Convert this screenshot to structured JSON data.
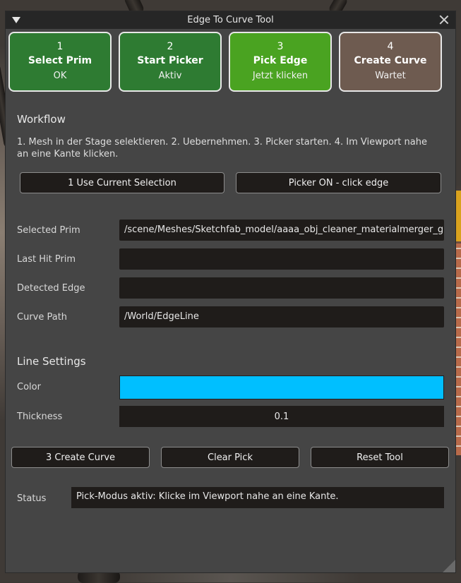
{
  "window": {
    "title": "Edge To Curve Tool"
  },
  "steps": [
    {
      "num": "1",
      "title": "Select Prim",
      "state": "OK"
    },
    {
      "num": "2",
      "title": "Start Picker",
      "state": "Aktiv"
    },
    {
      "num": "3",
      "title": "Pick Edge",
      "state": "Jetzt klicken"
    },
    {
      "num": "4",
      "title": "Create Curve",
      "state": "Wartet"
    }
  ],
  "workflow": {
    "title": "Workflow",
    "description": "1. Mesh in der Stage selektieren. 2. Uebernehmen. 3. Picker starten. 4. Im Viewport nahe an eine Kante klicken.",
    "use_selection_label": "1  Use Current Selection",
    "picker_label": "Picker ON - click edge"
  },
  "fields": {
    "selected_prim_label": "Selected Prim",
    "selected_prim_value": "/scene/Meshes/Sketchfab_model/aaaa_obj_cleaner_materialmerger_g",
    "last_hit_label": "Last Hit Prim",
    "last_hit_value": "",
    "detected_edge_label": "Detected Edge",
    "detected_edge_value": "",
    "curve_path_label": "Curve Path",
    "curve_path_value": "/World/EdgeLine"
  },
  "line_settings": {
    "title": "Line Settings",
    "color_label": "Color",
    "color_value": "#00bfff",
    "thickness_label": "Thickness",
    "thickness_value": "0.1"
  },
  "actions": {
    "create_curve": "3  Create Curve",
    "clear_pick": "Clear Pick",
    "reset_tool": "Reset Tool"
  },
  "status": {
    "label": "Status",
    "value": "Pick-Modus aktiv: Klicke im Viewport nahe an eine Kante."
  },
  "colors": {
    "step_done": "#2e7b32",
    "step_current": "#4aa321",
    "step_waiting": "#6e5b50",
    "panel_bg": "#454545",
    "field_bg": "#1f1c1a"
  }
}
